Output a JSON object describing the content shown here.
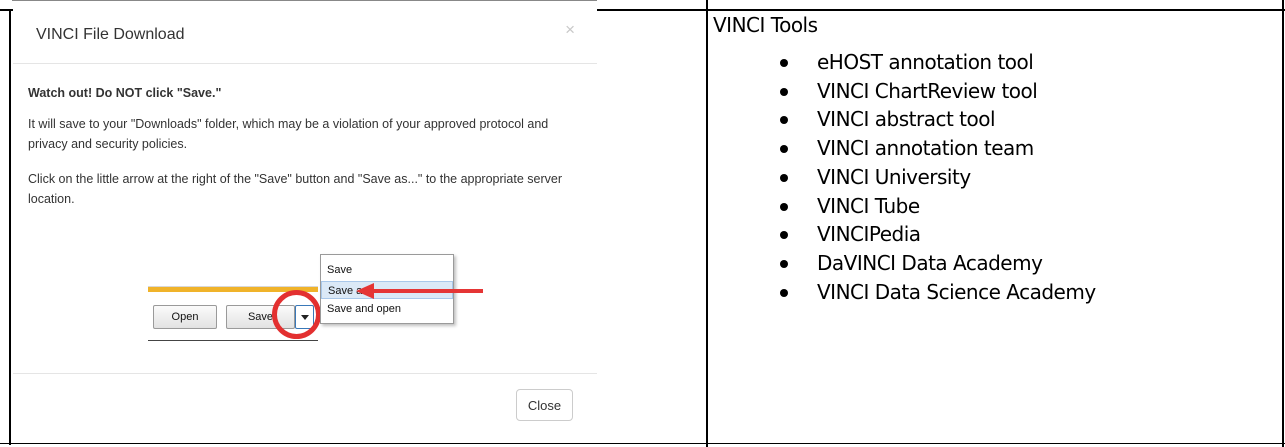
{
  "dialog": {
    "title": "VINCI File Download",
    "close_icon": "×",
    "warning": "Watch out! Do NOT click \"Save.\"",
    "paragraph_1": "It will save to your \"Downloads\" folder, which may be a violation of your approved protocol and privacy and security policies.",
    "paragraph_2": "Click on the little arrow at the right of the \"Save\" button and \"Save as...\" to the appropriate server location.",
    "close_button": "Close"
  },
  "illustration": {
    "open_button": "Open",
    "save_button": "Save",
    "menu_items": [
      "Save",
      "Save as",
      "Save and open"
    ],
    "highlighted_item": "Save as",
    "highlight_color": "#e33030"
  },
  "tools_panel": {
    "title": "VINCI Tools",
    "items": [
      "eHOST annotation tool",
      "VINCI ChartReview tool",
      "VINCI abstract tool",
      "VINCI annotation team",
      "VINCI University",
      "VINCI Tube",
      "VINCIPedia",
      "DaVINCI Data Academy",
      "VINCI Data Science Academy"
    ]
  }
}
